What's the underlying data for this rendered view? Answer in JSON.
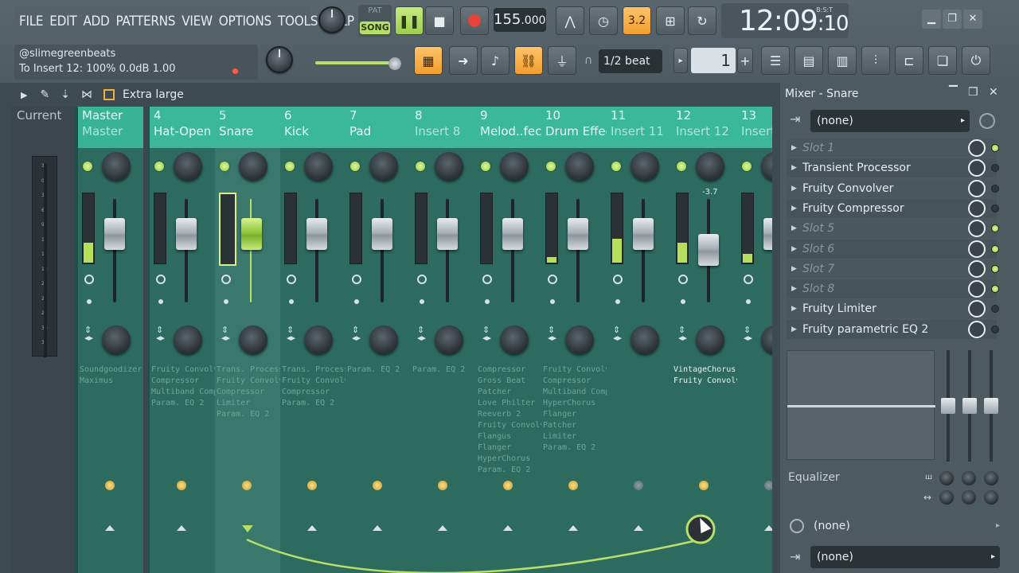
{
  "menu": [
    "FILE",
    "EDIT",
    "ADD",
    "PATTERNS",
    "VIEW",
    "OPTIONS",
    "TOOLS",
    "HELP"
  ],
  "transport": {
    "pat_label": "PAT",
    "song_label": "SONG",
    "play_icon": "pause-icon",
    "stop_icon": "stop-icon",
    "record_icon": "record-icon",
    "tempo": "155",
    "tempo_dec": ".000",
    "step": "3.2"
  },
  "clock": {
    "time": "12:09",
    "sub": ":10",
    "label": "B:S:T"
  },
  "hint": {
    "line1": "@slimegreenbeats",
    "line2": "To Insert 12: 100%  0.0dB  1.00"
  },
  "snap": {
    "value": "1/2 beat"
  },
  "pattern": {
    "number": "1"
  },
  "view_bar": {
    "size_label": "Extra large"
  },
  "mixer": {
    "current_label": "Current",
    "meter_scale": [
      "3",
      "0",
      "3",
      "6",
      "9",
      "12",
      "15",
      "18",
      "21",
      "24",
      "27",
      "30",
      "33"
    ],
    "tracks": [
      {
        "num": "Master",
        "name": "Master",
        "name_dim": true,
        "fx": [
          "Soundgoodizer",
          "Maximus"
        ],
        "meter": 0.28,
        "fader": 0.8
      },
      {
        "num": "4",
        "name": "Hat-Open",
        "fx": [
          "Fruity Convolver",
          "Compressor",
          "Multiband Comp",
          "Param. EQ 2"
        ],
        "meter": 0,
        "fader": 0.8
      },
      {
        "num": "5",
        "name": "Snare",
        "selected": true,
        "fx": [
          "Trans. Processor",
          "Fruity Convolver",
          "Compressor",
          "Limiter",
          "Param. EQ 2"
        ],
        "meter": 0,
        "fader": 0.8
      },
      {
        "num": "6",
        "name": "Kick",
        "fx": [
          "Trans. Processor",
          "Fruity Convolver",
          "Compressor",
          "Param. EQ 2"
        ],
        "meter": 0,
        "fader": 0.8
      },
      {
        "num": "7",
        "name": "Pad",
        "fx": [
          "Param. EQ 2"
        ],
        "meter": 0,
        "fader": 0.8
      },
      {
        "num": "8",
        "name": "Insert 8",
        "name_dim": true,
        "fx": [
          "Param. EQ 2"
        ],
        "meter": 0,
        "fader": 0.8
      },
      {
        "num": "9",
        "name": "Melod..fects",
        "fx": [
          "Compressor",
          "Gross Beat",
          "Patcher",
          "Love Philter",
          "Reeverb 2",
          "Fruity Convolver",
          "Flangus",
          "Flanger",
          "HyperChorus",
          "Param. EQ 2"
        ],
        "meter": 0,
        "fader": 0.8
      },
      {
        "num": "10",
        "name": "Drum Effects",
        "fx": [
          "Fruity Convolver",
          "Compressor",
          "Multiband Comp",
          "HyperChorus",
          "Flanger",
          "Patcher",
          "Limiter",
          "Param. EQ 2"
        ],
        "meter": 0.08,
        "fader": 0.8
      },
      {
        "num": "11",
        "name": "Insert 11",
        "name_dim": true,
        "fx": [],
        "meter": 0.34,
        "fader": 0.8
      },
      {
        "num": "12",
        "name": "Insert 12",
        "name_dim": true,
        "fx_bright": true,
        "fx": [
          "VintageChorus",
          "Fruity Convolver"
        ],
        "meter": 0.28,
        "fader": 0.55,
        "db": "-3.7"
      },
      {
        "num": "13",
        "name": "Insert",
        "name_dim": true,
        "fx": [],
        "meter": 0.12,
        "fader": 0.8
      }
    ]
  },
  "panel": {
    "title": "Mixer - Snare",
    "input": "(none)",
    "slots": [
      {
        "name": "Slot 1",
        "empty": true,
        "on": true
      },
      {
        "name": "Transient Processor",
        "empty": false,
        "on": false
      },
      {
        "name": "Fruity Convolver",
        "empty": false,
        "on": false
      },
      {
        "name": "Fruity Compressor",
        "empty": false,
        "on": false
      },
      {
        "name": "Slot 5",
        "empty": true,
        "on": true
      },
      {
        "name": "Slot 6",
        "empty": true,
        "on": true
      },
      {
        "name": "Slot 7",
        "empty": true,
        "on": true
      },
      {
        "name": "Slot 8",
        "empty": true,
        "on": true
      },
      {
        "name": "Fruity Limiter",
        "empty": false,
        "on": false
      },
      {
        "name": "Fruity parametric EQ 2",
        "empty": false,
        "on": false
      }
    ],
    "eq_label": "Equalizer",
    "output_send": "(none)",
    "output": "(none)"
  },
  "colors": {
    "accent_green": "#b6e06a",
    "accent_orange": "#f29d2c",
    "mixer_bg": "#234e46",
    "header_teal": "#3ab897"
  }
}
